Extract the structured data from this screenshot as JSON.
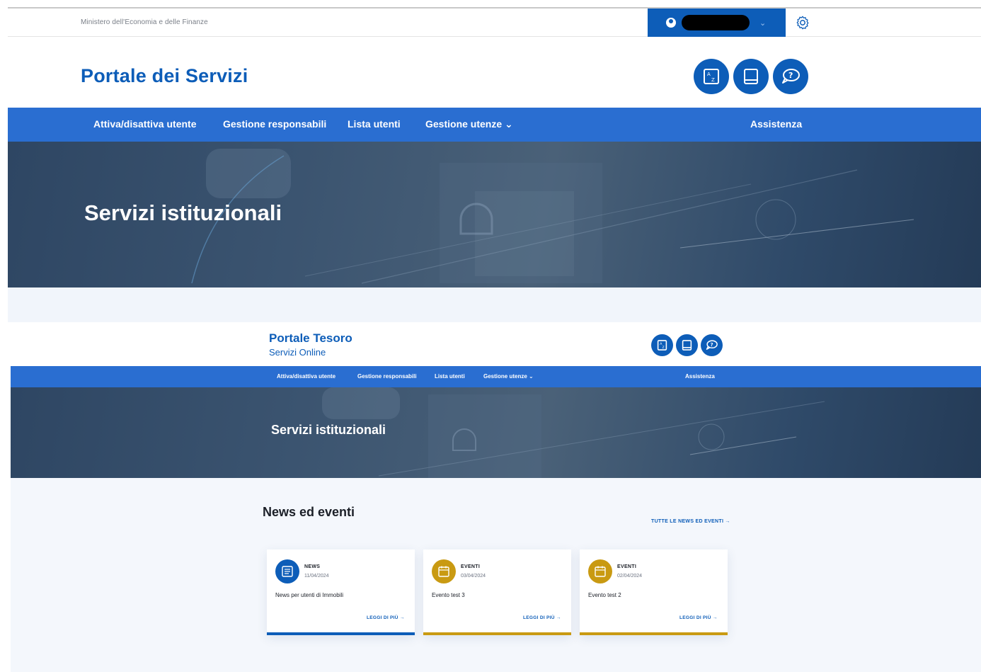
{
  "top_bar": {
    "ministry": "Ministero dell'Economia e delle Finanze",
    "user_chevron": "⌄"
  },
  "header": {
    "title": "Portale dei Servizi",
    "icons": [
      "glossary-icon",
      "manual-icon",
      "help-icon"
    ]
  },
  "nav": {
    "items": [
      "Attiva/disattiva utente",
      "Gestione responsabili",
      "Lista utenti",
      "Gestione utenze ⌄"
    ],
    "assistance": "Assistenza"
  },
  "hero": {
    "title": "Servizi istituzionali"
  },
  "inner": {
    "title": "Portale Tesoro",
    "subtitle": "Servizi Online",
    "nav": {
      "items": [
        "Attiva/disattiva utente",
        "Gestione responsabili",
        "Lista utenti",
        "Gestione utenze ⌄"
      ],
      "assistance": "Assistenza"
    },
    "hero_title": "Servizi istituzionali",
    "news": {
      "title": "News ed eventi",
      "all_link": "TUTTE LE NEWS ED EVENTI →",
      "cards": [
        {
          "type": "NEWS",
          "date": "11/04/2024",
          "text": "News per utenti di Immobili",
          "more": "LEGGI DI PIÙ →",
          "color": "#0d5db8",
          "icon": "news-icon"
        },
        {
          "type": "EVENTI",
          "date": "03/04/2024",
          "text": "Evento test 3",
          "more": "LEGGI DI PIÙ →",
          "color": "#c99a12",
          "icon": "calendar-icon"
        },
        {
          "type": "EVENTI",
          "date": "02/04/2024",
          "text": "Evento test 2",
          "more": "LEGGI DI PIÙ →",
          "color": "#c99a12",
          "icon": "calendar-icon"
        }
      ]
    }
  },
  "colors": {
    "primary": "#0d5db8",
    "nav": "#2a6ed1",
    "event": "#c99a12"
  }
}
